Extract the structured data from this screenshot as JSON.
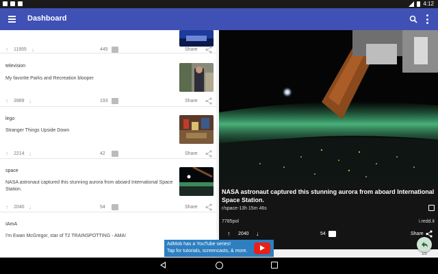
{
  "status": {
    "time": "4:12"
  },
  "appbar": {
    "title": "Dashboard"
  },
  "feed": {
    "items": [
      {
        "subreddit": "",
        "title": "",
        "score": "11955",
        "comments": "445",
        "share": "Share"
      },
      {
        "subreddit": "television",
        "title": "My favorite Parks and Recreation blooper",
        "score": "3989",
        "comments": "193",
        "share": "Share"
      },
      {
        "subreddit": "lego",
        "title": "Stranger Things Upside Down",
        "score": "2214",
        "comments": "42",
        "share": "Share"
      },
      {
        "subreddit": "space",
        "title": "NASA astronaut captured this stunning aurora from aboard International Space Station.",
        "score": "2040",
        "comments": "54",
        "share": "Share"
      },
      {
        "subreddit": "IAmA",
        "title": "I'm Ewan McGregor, star of T2 TRAINSPOTTING - AMA!",
        "score": "",
        "comments": "",
        "share": ""
      }
    ]
  },
  "detail": {
    "title": "NASA astronaut captured this stunning aurora from aboard International Space Station.",
    "meta": "r/space-13h 15m 46s",
    "author": "7785pol",
    "domain": "i.redd.it",
    "score": "2040",
    "comments": "54",
    "share": "Share",
    "next_count": "15"
  },
  "ad": {
    "line1": "AdMob has a YouTube series!",
    "line2": "Tap for tutorials, screencasts, & more."
  },
  "colors": {
    "appbar": "#3f51b5",
    "ad": "#2d7fc1",
    "youtube": "#e62117"
  }
}
